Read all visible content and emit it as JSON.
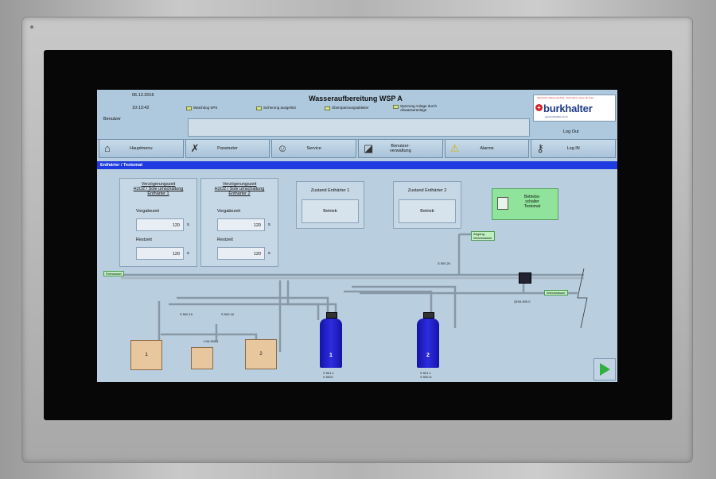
{
  "header": {
    "date": "06.12.2016",
    "time": "10:13:42",
    "user_label": "Benutzer",
    "title": "Wasseraufbereitung WSP A",
    "status": [
      {
        "label": "Watchdog SPS"
      },
      {
        "label": "Sicherung ausgelöst"
      },
      {
        "label": "Überspannungsableiter"
      },
      {
        "label": "Sperrung Anlage durch Abwasseranlage"
      }
    ],
    "logo": {
      "tagline": "Schweizer Wassertechnik · Technique suisse de l'eau",
      "name": "burkhalter",
      "url": "www.burkhalter-wt.ch"
    },
    "logout": "Log Out"
  },
  "nav": [
    {
      "label": "Hauptmenu",
      "icon": "home-icon"
    },
    {
      "label": "Parameter",
      "icon": "wrench-icon"
    },
    {
      "label": "Service",
      "icon": "service-person-icon"
    },
    {
      "label": "Benutzer-\nverwaltung",
      "icon": "user-management-icon"
    },
    {
      "label": "Alarme",
      "icon": "warning-icon"
    },
    {
      "label": "Log IN",
      "icon": "key-icon"
    }
  ],
  "breadcrumb": "Enthärter / Testomat",
  "panels": [
    {
      "title": "Verzögerungszeit\nH2O2 / Sole umschaltung\nEnthärter 1",
      "vorgabe_label": "Vorgabezeit",
      "vorgabe_value": "120",
      "rest_label": "Restzeit",
      "rest_value": "120",
      "unit": "s"
    },
    {
      "title": "Verzögerungszeit\nH2O2 / Sole umschaltung\nEnthärter 2",
      "vorgabe_label": "Vorgabezeit",
      "vorgabe_value": "120",
      "rest_label": "Restzeit",
      "rest_value": "120",
      "unit": "s"
    }
  ],
  "zustand": [
    {
      "title": "Zustand Enthärter 1",
      "value": "Betrieb"
    },
    {
      "title": "Zustand Enthärter 2",
      "value": "Betrieb"
    }
  ],
  "betriebsschalter": "Betriebs-\nschalter\nTestomat",
  "diagram": {
    "rohwasser": "Rohwasser",
    "abgang": "Abgang\nWeichwasser",
    "weichwasser": "Weichwasser",
    "s50020": "S 500.20",
    "s50015": "S 500.15",
    "s50016": "S 500.16",
    "lsa5001": "LSA 500.1",
    "qisa": "QISA 500.0",
    "v1_label": "1",
    "v1_tags": "S 501.1\nS 5002",
    "v2_label": "2",
    "v2_tags": "S 501.1\nS 500.D",
    "tank1": "1",
    "tank2": "2"
  }
}
